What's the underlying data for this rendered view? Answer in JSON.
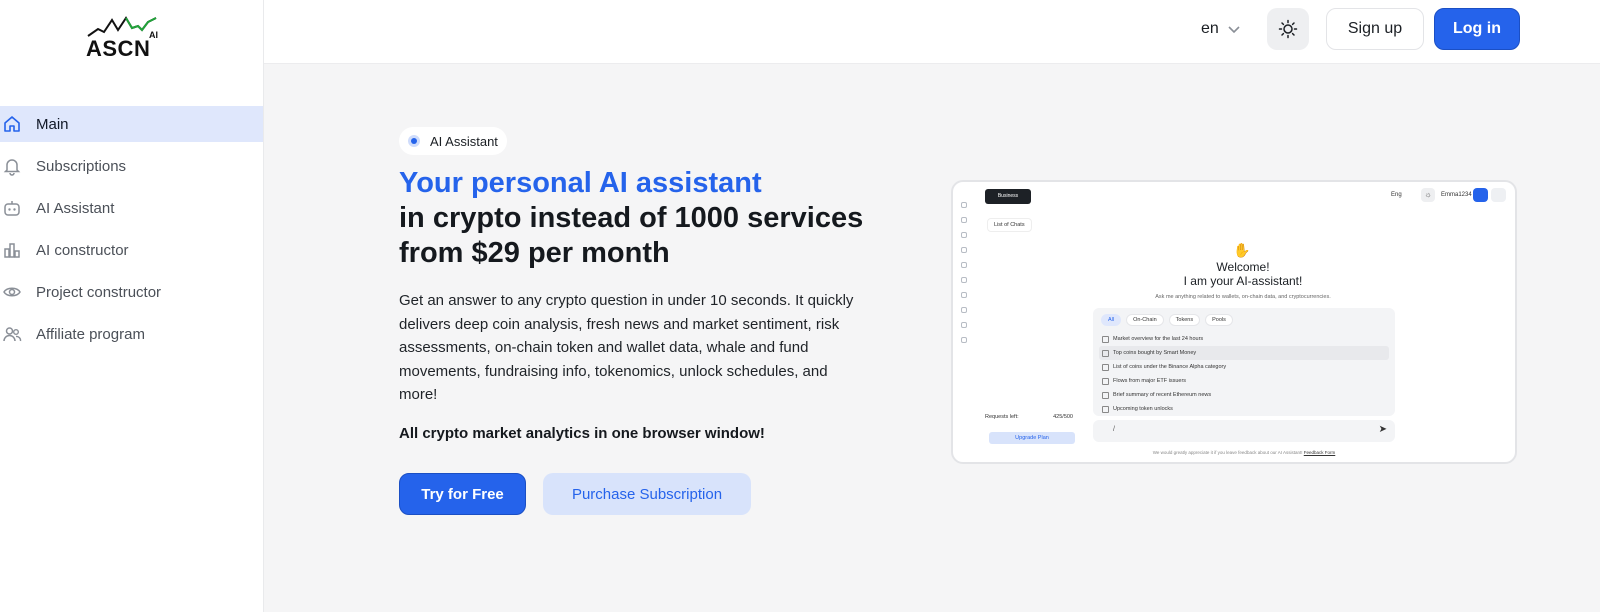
{
  "brand": {
    "name": "ASCN",
    "suffix": "AI"
  },
  "sidebar": {
    "items": [
      {
        "label": "Main",
        "icon": "home-icon",
        "active": true
      },
      {
        "label": "Subscriptions",
        "icon": "bell-icon",
        "active": false
      },
      {
        "label": "AI Assistant",
        "icon": "robot-icon",
        "active": false
      },
      {
        "label": "AI constructor",
        "icon": "bar-chart-icon",
        "active": false
      },
      {
        "label": "Project constructor",
        "icon": "eye-icon",
        "active": false
      },
      {
        "label": "Affiliate program",
        "icon": "users-icon",
        "active": false
      }
    ]
  },
  "header": {
    "language": "en",
    "signup_label": "Sign up",
    "login_label": "Log in"
  },
  "hero": {
    "badge": "AI Assistant",
    "title_accent": "Your personal AI assistant",
    "title_line2": "in crypto instead of 1000 services",
    "title_line3": "from $29 per month",
    "description": "Get an answer to any crypto question in under 10 seconds. It quickly delivers deep coin analysis, fresh news and market sentiment, risk assessments, on-chain token and wallet data, whale and fund movements, fundraising info, tokenomics, unlock schedules, and more!",
    "tagline": "All crypto market analytics in one browser window!",
    "try_label": "Try for Free",
    "purchase_label": "Purchase Subscription"
  },
  "preview": {
    "plan_badge": "Business",
    "language": "Eng",
    "username": "Emma1234",
    "list_of_chats": "List of Chats",
    "welcome_line1": "Welcome!",
    "welcome_line2": "I am your AI-assistant!",
    "ask_text": "Ask me anything related to wallets, on-chain data, and cryptocurrencies.",
    "tabs": [
      "All",
      "On-Chain",
      "Tokens",
      "Pools"
    ],
    "suggestions": [
      "Market overview for the last 24 hours",
      "Top coins bought by Smart Money",
      "List of coins under the Binance Alpha category",
      "Flows from major ETF issuers",
      "Brief summary of recent Ethereum news",
      "Upcoming token unlocks"
    ],
    "input_value": "/",
    "requests_label": "Requests left:",
    "requests_value": "425/500",
    "upgrade_label": "Upgrade Plan",
    "feedback_text": "We would greatly appreciate it if you leave feedback about our AI Assistant!",
    "feedback_link": "Feedback Form"
  },
  "colors": {
    "accent": "#2563eb",
    "accent_light": "#d8e3fb",
    "active_nav": "#dfe7fc"
  }
}
